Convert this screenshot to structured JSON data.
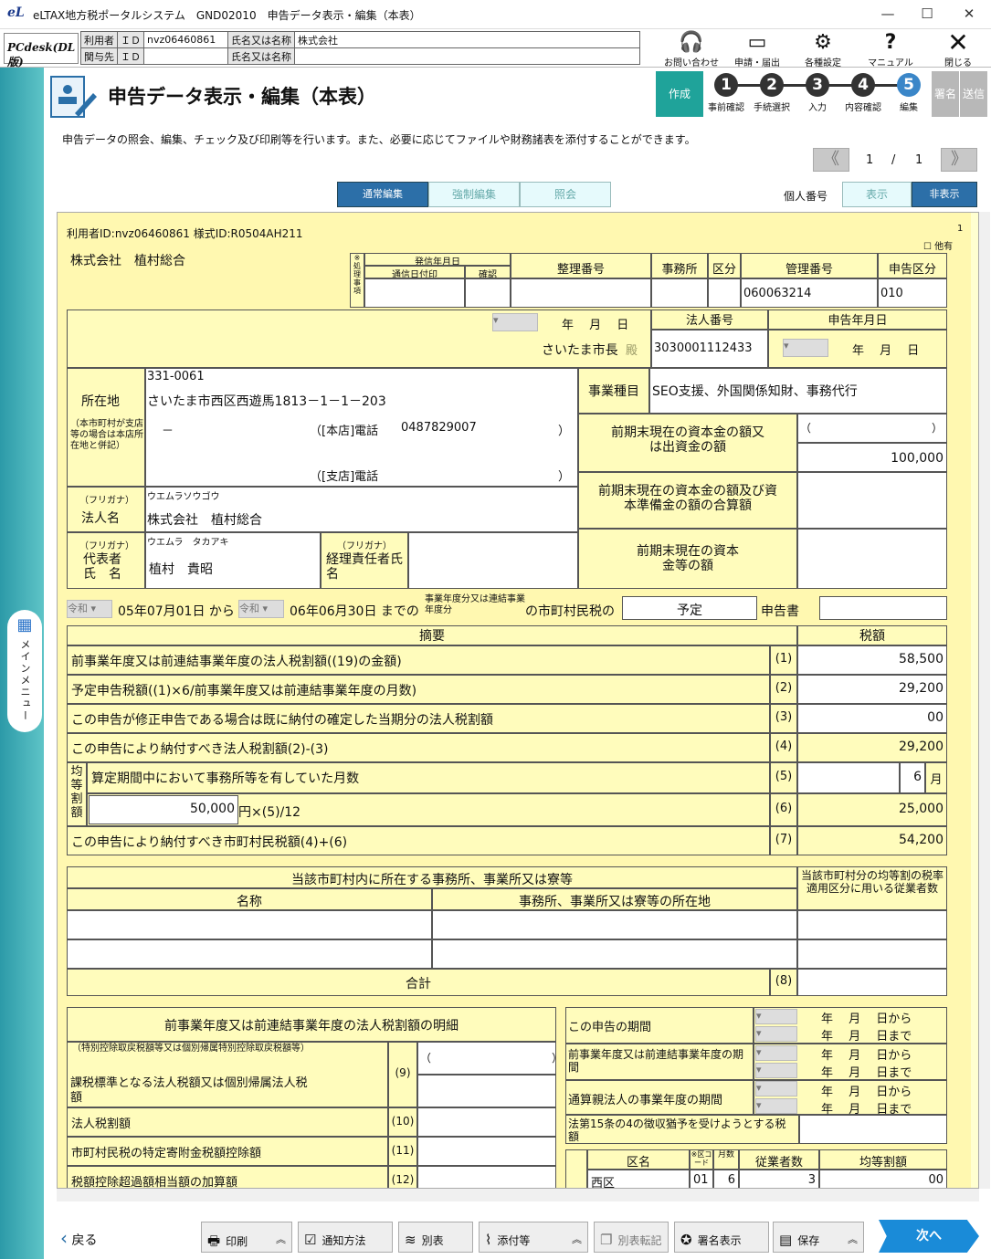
{
  "titlebar": {
    "logo": "eL",
    "title": "eLTAX地方税ポータルシステム　GND02010　申告データ表示・編集（本表）",
    "min": "—",
    "max": "☐",
    "close": "✕"
  },
  "userbar": {
    "brand": "PCdesk(DL版)",
    "user_label": "利用者",
    "id_label": "ＩＤ",
    "user_id": "nvz06460861",
    "name_label": "氏名又は名称",
    "name": "株式会社",
    "rel_label": "関与先",
    "rel_id_label": "ＩＤ",
    "rel_id": "",
    "rel_name_label": "氏名又は名称",
    "rel_name": ""
  },
  "tools": [
    {
      "icon": "headset-icon",
      "glyph": "🎧",
      "label": "お問い合わせ"
    },
    {
      "icon": "window-icon",
      "glyph": "▭",
      "label": "申請・届出"
    },
    {
      "icon": "gear-icon",
      "glyph": "⚙",
      "label": "各種設定"
    },
    {
      "icon": "help-icon",
      "glyph": "?",
      "label": "マニュアル"
    },
    {
      "icon": "close-icon",
      "glyph": "✕",
      "label": "閉じる"
    }
  ],
  "mainmenu": {
    "label": "メインメニュー",
    "glyph": "▦"
  },
  "header": {
    "title": "申告データ表示・編集（本表）",
    "current": "作成",
    "steps": [
      {
        "n": "1",
        "label": "事前確認"
      },
      {
        "n": "2",
        "label": "手続選択"
      },
      {
        "n": "3",
        "label": "入力"
      },
      {
        "n": "4",
        "label": "内容確認"
      },
      {
        "n": "5",
        "label": "編集"
      }
    ],
    "sign": "署名",
    "send": "送信"
  },
  "description": "申告データの照会、編集、チェック及び印刷等を行います。また、必要に応じてファイルや財務諸表を添付することができます。",
  "pager": {
    "prev": "《",
    "current": "1",
    "sep": "/",
    "total": "1",
    "next": "》"
  },
  "modes": {
    "normal": "通常編集",
    "force": "強制編集",
    "view": "照会",
    "personal_label": "個人番号",
    "show": "表示",
    "hide": "非表示"
  },
  "form": {
    "header_line": "利用者ID:nvz06460861 様式ID:R0504AH211",
    "page_no": "1",
    "other": "他有",
    "company_top": "株式会社　植村総合",
    "mark": "※処理事項",
    "h_date": "発信年月日",
    "h_recv": "通信日付印",
    "h_check": "確認",
    "h_seiri": "整理番号",
    "h_office": "事務所",
    "h_kubun": "区分",
    "h_kanri": "管理番号",
    "h_shinkoku": "申告区分",
    "kanri_no": "060063214",
    "shinkoku_kubun": "010",
    "ymd": "年　 月　 日",
    "mayor": "さいたま市長",
    "tono": "殿",
    "h_houjin": "法人番号",
    "houjin_no": "3030001112433",
    "h_shinkoku_date": "申告年月日",
    "addr_label": "所在地",
    "addr_note": "（本市町村が支店等の場合は本店所在地と併記）",
    "zip": "331-0061",
    "address": "さいたま市西区西遊馬1813－1－1－203",
    "dash": "－",
    "tel_main_label": "（[本店]電話",
    "tel_main": "0487829007",
    "tel_branch_label": "（[支店]電話",
    "paren_close": "）",
    "biz_label": "事業種目",
    "biz": "SEO支援、外国関係知財、事務代行",
    "cap1": "前期末現在の資本金の額又は出資金の額",
    "cap_paren": "（　　　　　　　　　　　）",
    "cap1_val": "100,000",
    "cap2": "前期末現在の資本金の額及び資本準備金の額の合算額",
    "cap3": "前期末現在の資本金等の額",
    "furigana": "（フリガナ）",
    "corp_kana": "ウエムラソウゴウ",
    "corp_label": "法人名",
    "corp_name": "株式会社　植村総合",
    "rep_kana": "ウエムラ　タカアキ",
    "rep_label": "代表者氏　名",
    "rep_name": "植村　貴昭",
    "acct_label": "経理責任者氏　　名",
    "era": "令和",
    "from": "05年07月01日 から",
    "to": "06年06月30日 までの",
    "period_note": "事業年度分又は連結事業年度分",
    "tax_label": "の市町村民税の",
    "yotei": "予定",
    "shinkokusho": "申告書",
    "h_summary": "摘要",
    "h_tax": "税額",
    "rows": [
      {
        "label": "前事業年度又は前連結事業年度の法人税割額((19)の金額)",
        "no": "(1)",
        "val": "58,500"
      },
      {
        "label": "予定申告税額((1)×6/前事業年度又は前連結事業年度の月数)",
        "no": "(2)",
        "val": "29,200"
      },
      {
        "label": "この申告が修正申告である場合は既に納付の確定した当期分の法人税割額",
        "no": "(3)",
        "val": "00"
      },
      {
        "label": "この申告により納付すべき法人税割額(2)-(3)",
        "no": "(4)",
        "val": "29,200"
      }
    ],
    "kinto": "均等割額",
    "months_label": "算定期間中において事務所等を有していた月数",
    "no5": "(5)",
    "months": "6",
    "tsuki": "月",
    "kinto_base": "50,000",
    "kinto_formula": "円×(5)/12",
    "no6": "(6)",
    "kinto_val": "25,000",
    "total_label": "この申告により納付すべき市町村民税額(4)+(6)",
    "no7": "(7)",
    "total_val": "54,200",
    "office_h": "当該市町村内に所在する事務所、事業所又は寮等",
    "office_emp": "当該市町村分の均等割の税率適用区分に用いる従業者数",
    "office_name": "名称",
    "office_addr": "事務所、事業所又は寮等の所在地",
    "goukei": "合計",
    "no8": "(8)",
    "prev_h": "前事業年度又は前連結事業年度の法人税割額の明細",
    "r9_note": "（特別控除取戻税額等又は個別帰属特別控除取戻税額等）",
    "r9": "課税標準となる法人税額又は個別帰属法人税額",
    "no9": "(9)",
    "r10": "法人税割額",
    "no10": "(10)",
    "r11": "市町村民税の特定寄附金税額控除額",
    "no11": "(11)",
    "r12": "税額控除超過額相当額の加算額",
    "no12": "(12)",
    "p1": "この申告の期間",
    "p2": "前事業年度又は前連結事業年度の期間",
    "p3": "通算親法人の事業年度の期間",
    "p4": "法第15条の4の徴収猶予を受けようとする税額",
    "kara": "年　 月　 日から",
    "made": "年　 月　 日まで",
    "ku": "区名",
    "kucode": "※区コード",
    "tsukisu": "月数",
    "emp": "従業者数",
    "kinto_amt": "均等割額",
    "ku_name": "西区",
    "ku_code": "01",
    "ku_months": "6",
    "ku_emp": "3",
    "ku_amt": "00"
  },
  "bottom": {
    "back": "戻る",
    "print": "印刷",
    "notify": "通知方法",
    "betsu": "別表",
    "attach": "添付等",
    "copy": "別表転記",
    "sign": "署名表示",
    "save": "保存",
    "next": "次へ"
  }
}
